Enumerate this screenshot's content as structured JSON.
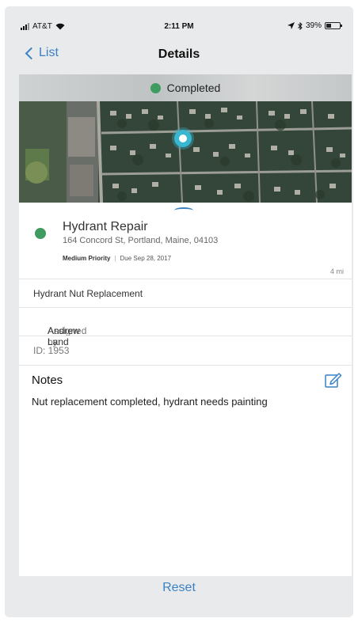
{
  "status_bar": {
    "carrier": "AT&T",
    "time": "2:11 PM",
    "battery": "39%",
    "battery_level": 0.39
  },
  "nav": {
    "back_label": "List",
    "title": "Details"
  },
  "status": {
    "label": "Completed",
    "color": "#3f9b5f"
  },
  "work_order": {
    "title": "Hydrant Repair",
    "address": "164 Concord St, Portland, Maine, 04103",
    "priority": "Medium Priority",
    "due": "Due Sep 28, 2017",
    "distance": "4 mi"
  },
  "details": {
    "type": "Hydrant Nut Replacement",
    "assigned_prefix": "Assigned by:",
    "assigned_name": "Andrew Land",
    "id": "ID: 1953"
  },
  "notes": {
    "heading": "Notes",
    "text": "Nut replacement  completed, hydrant needs painting"
  },
  "footer": {
    "reset_label": "Reset"
  },
  "colors": {
    "accent": "#3a82c4",
    "pin": "#3ab7d0"
  }
}
